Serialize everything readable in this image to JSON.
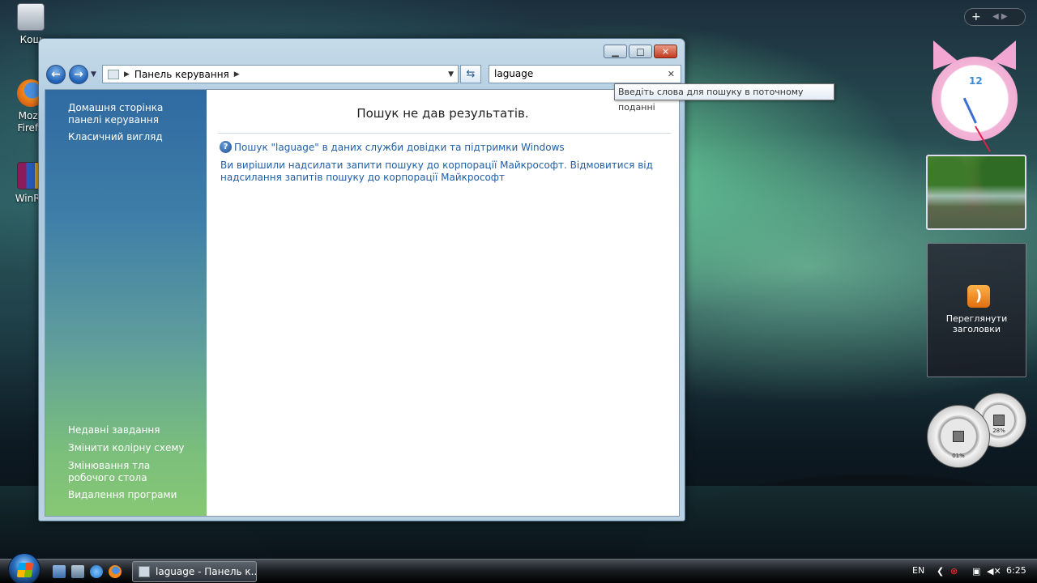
{
  "desktop": {
    "icons": [
      {
        "label": "Кош",
        "name": "recycle-bin"
      },
      {
        "label": "Mozil Firefo",
        "name": "firefox"
      },
      {
        "label": "WinRA",
        "name": "winrar"
      }
    ]
  },
  "window": {
    "address": {
      "crumb": "Панель керування"
    },
    "search": {
      "value": "laguage"
    },
    "tooltip": "Введіть слова для пошуку в поточному поданні",
    "sidebar": {
      "top_links": [
        "Домашня сторінка панелі керування",
        "Класичний вигляд"
      ],
      "bottom_links": [
        "Недавні завдання",
        "Змінити колірну схему",
        "Змінювання тла робочого стола",
        "Видалення програми"
      ]
    },
    "content": {
      "no_results": "Пошук не дав результатів.",
      "help_link": "Пошук \"laguage\" в даних служби довідки та підтримки Windows",
      "ms_link": "Ви вирішили надсилати запити пошуку до корпорації Майкрософт. Відмовитися від надсилання запитів пошуку до корпорації Майкрософт"
    }
  },
  "gadgets": {
    "clock_label": "12",
    "feed_label": "Переглянути заголовки",
    "cpu_percent": "01%",
    "mem_percent": "28%"
  },
  "taskbar": {
    "task_label": "laguage - Панель к...",
    "lang": "EN",
    "time": "6:25"
  }
}
